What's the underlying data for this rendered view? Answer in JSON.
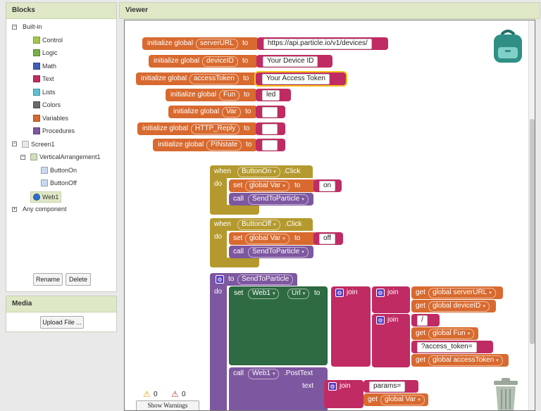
{
  "panels": {
    "blocks_title": "Blocks",
    "viewer_title": "Viewer",
    "media_title": "Media"
  },
  "tree": {
    "builtin": "Built-in",
    "items": [
      {
        "label": "Control",
        "color": "#a7c74b"
      },
      {
        "label": "Logic",
        "color": "#77b043"
      },
      {
        "label": "Math",
        "color": "#3d5fb7"
      },
      {
        "label": "Text",
        "color": "#c02b63"
      },
      {
        "label": "Lists",
        "color": "#5ac2d4"
      },
      {
        "label": "Colors",
        "color": "#6a6a6a"
      },
      {
        "label": "Variables",
        "color": "#d86a2f"
      },
      {
        "label": "Procedures",
        "color": "#7d579f"
      }
    ],
    "screen": "Screen1",
    "arrangement": "VerticalArrangement1",
    "button_on": "ButtonOn",
    "button_off": "ButtonOff",
    "web": "Web1",
    "any": "Any component"
  },
  "buttons": {
    "rename": "Rename",
    "delete": "Delete",
    "upload": "Upload File ..."
  },
  "globals": [
    {
      "name": "serverURL",
      "value": "https://api.particle.io/v1/devices/"
    },
    {
      "name": "deviceID",
      "value": "Your Device ID"
    },
    {
      "name": "accessToken",
      "value": "Your Access Token"
    },
    {
      "name": "Fun",
      "value": "led"
    },
    {
      "name": "Var",
      "value": ""
    },
    {
      "name": "HTTP_Reply",
      "value": ""
    },
    {
      "name": "PINstate",
      "value": ""
    }
  ],
  "kw": {
    "init": "initialize global",
    "to": "to",
    "when": "when",
    "do": "do",
    "set": "set",
    "call": "call",
    "click": ".Click",
    "join": "join",
    "get": "get",
    "url": "Url",
    "posttext": ".PostText",
    "text": "text",
    "global_var": "global Var",
    "proc": "SendToParticle",
    "web": "Web1",
    "on": "on",
    "off": "off",
    "slash": "/",
    "access_token": "?access_token=",
    "params": "params=",
    "g_server": "global serverURL",
    "g_device": "global deviceID",
    "g_fun": "global Fun",
    "g_token": "global accessToken"
  },
  "events": [
    {
      "component": "ButtonOn",
      "value": "on"
    },
    {
      "component": "ButtonOff",
      "value": "off"
    }
  ],
  "warnings": {
    "warn_count": "0",
    "error_count": "0",
    "show_label": "Show Warnings"
  },
  "colors": {
    "variable": "#d86a2f",
    "text": "#c02b63",
    "control": "#b49a2e",
    "procedure": "#7d579f",
    "component": "#2e6b42",
    "accent": "#5a3fc5",
    "header": "#dfe8c6"
  }
}
